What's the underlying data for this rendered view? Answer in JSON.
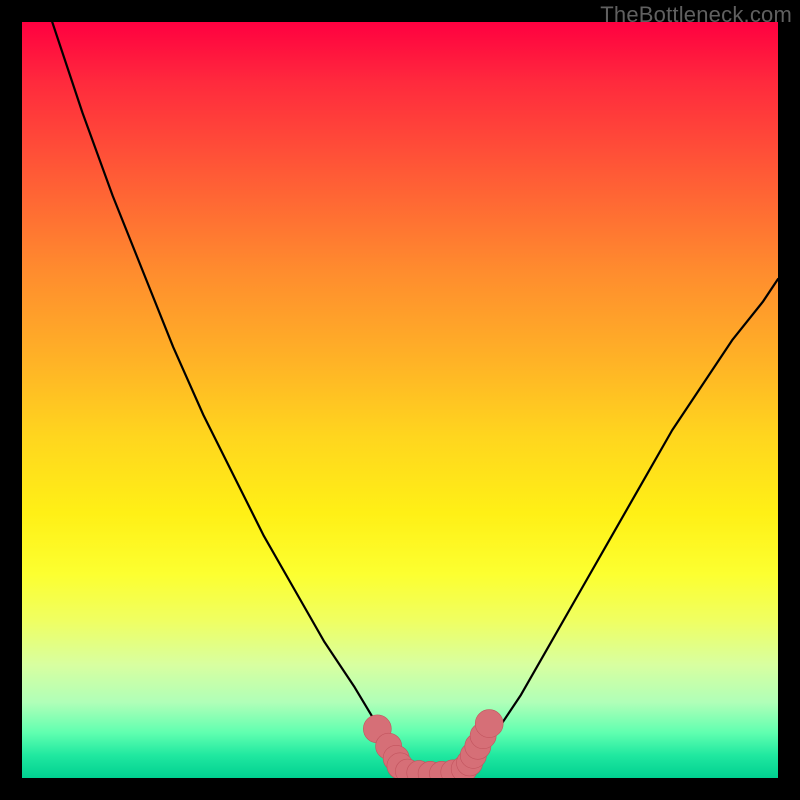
{
  "watermark": "TheBottleneck.com",
  "colors": {
    "frame": "#000000",
    "curve": "#000000",
    "marker_fill": "#d66f77",
    "marker_stroke": "#c2545e"
  },
  "chart_data": {
    "type": "line",
    "title": "",
    "xlabel": "",
    "ylabel": "",
    "xlim": [
      0,
      100
    ],
    "ylim": [
      0,
      100
    ],
    "series": [
      {
        "name": "left-curve",
        "x": [
          4,
          8,
          12,
          16,
          20,
          24,
          28,
          32,
          36,
          40,
          44,
          47,
          49,
          50.5
        ],
        "y": [
          100,
          88,
          77,
          67,
          57,
          48,
          40,
          32,
          25,
          18,
          12,
          7,
          3.5,
          1.5
        ]
      },
      {
        "name": "valley-floor",
        "x": [
          50.5,
          52,
          54,
          56,
          58,
          59.5
        ],
        "y": [
          1.5,
          0.8,
          0.6,
          0.6,
          0.9,
          1.8
        ]
      },
      {
        "name": "right-curve",
        "x": [
          59.5,
          62,
          66,
          70,
          74,
          78,
          82,
          86,
          90,
          94,
          98,
          100
        ],
        "y": [
          1.8,
          5,
          11,
          18,
          25,
          32,
          39,
          46,
          52,
          58,
          63,
          66
        ]
      }
    ],
    "markers": [
      {
        "x": 47.0,
        "y": 6.5,
        "r": 1.1
      },
      {
        "x": 48.5,
        "y": 4.2,
        "r": 1.0
      },
      {
        "x": 49.5,
        "y": 2.6,
        "r": 1.0
      },
      {
        "x": 50.0,
        "y": 1.6,
        "r": 1.0
      },
      {
        "x": 51.0,
        "y": 0.9,
        "r": 0.9
      },
      {
        "x": 52.5,
        "y": 0.7,
        "r": 0.9
      },
      {
        "x": 54.0,
        "y": 0.6,
        "r": 0.9
      },
      {
        "x": 55.5,
        "y": 0.6,
        "r": 0.9
      },
      {
        "x": 57.0,
        "y": 0.8,
        "r": 0.9
      },
      {
        "x": 58.5,
        "y": 1.2,
        "r": 1.0
      },
      {
        "x": 59.2,
        "y": 2.0,
        "r": 1.0
      },
      {
        "x": 59.7,
        "y": 3.0,
        "r": 1.0
      },
      {
        "x": 60.3,
        "y": 4.2,
        "r": 1.0
      },
      {
        "x": 61.0,
        "y": 5.6,
        "r": 1.0
      },
      {
        "x": 61.8,
        "y": 7.2,
        "r": 1.1
      }
    ]
  }
}
